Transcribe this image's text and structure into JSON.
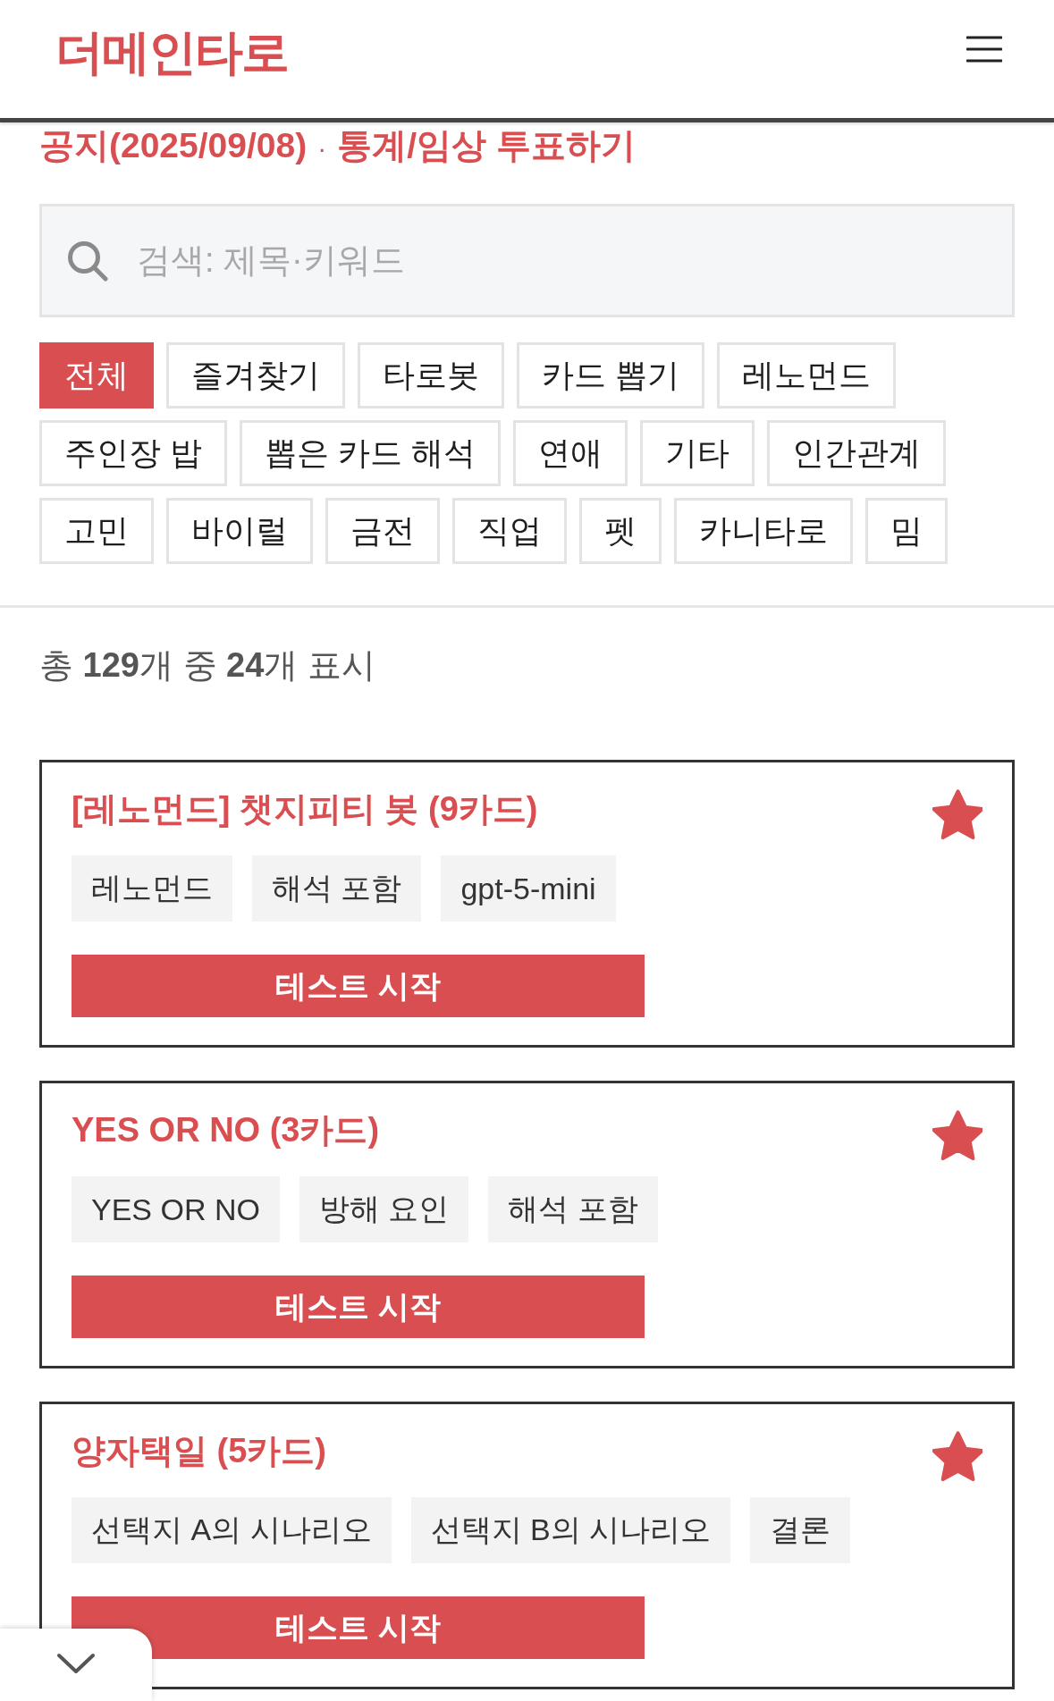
{
  "header": {
    "logo": "더메인타로"
  },
  "notice": {
    "links": [
      "공지(2025/09/08)",
      "통계/임상 투표하기"
    ],
    "separator": "·"
  },
  "search": {
    "placeholder": "검색: 제목·키워드"
  },
  "categories": [
    {
      "label": "전체",
      "selected": true
    },
    {
      "label": "즐겨찾기",
      "selected": false
    },
    {
      "label": "타로봇",
      "selected": false
    },
    {
      "label": "카드 뽑기",
      "selected": false
    },
    {
      "label": "레노먼드",
      "selected": false
    },
    {
      "label": "주인장 밥",
      "selected": false
    },
    {
      "label": "뽑은 카드 해석",
      "selected": false
    },
    {
      "label": "연애",
      "selected": false
    },
    {
      "label": "기타",
      "selected": false
    },
    {
      "label": "인간관계",
      "selected": false
    },
    {
      "label": "고민",
      "selected": false
    },
    {
      "label": "바이럴",
      "selected": false
    },
    {
      "label": "금전",
      "selected": false
    },
    {
      "label": "직업",
      "selected": false
    },
    {
      "label": "펫",
      "selected": false
    },
    {
      "label": "카니타로",
      "selected": false
    },
    {
      "label": "밈",
      "selected": false
    }
  ],
  "summary": "총 **129**개 중 **24**개 표시",
  "cards": [
    {
      "title": "[레노먼드] 챗지피티 봇 (9카드)",
      "favorite": true,
      "tags": [
        "레노먼드",
        "해석 포함",
        "gpt-5-mini"
      ],
      "button": "테스트 시작"
    },
    {
      "title": "YES OR NO (3카드)",
      "favorite": true,
      "tags": [
        "YES OR NO",
        "방해 요인",
        "해석 포함"
      ],
      "button": "테스트 시작"
    },
    {
      "title": "양자택일 (5카드)",
      "favorite": true,
      "tags": [
        "선택지 A의 시나리오",
        "선택지 B의 시나리오",
        "결론"
      ],
      "button": "테스트 시작"
    }
  ]
}
